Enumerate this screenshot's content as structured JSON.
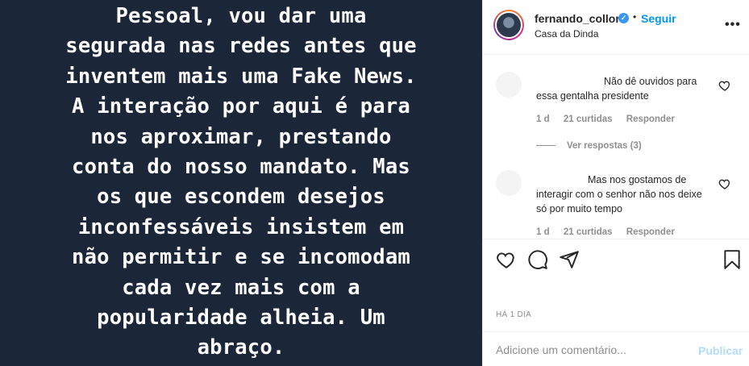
{
  "post": {
    "text_lines": [
      "Pessoal, vou dar uma",
      "segurada nas redes antes que",
      "inventem mais uma Fake News.",
      "A interação por aqui é para",
      "nos aproximar, prestando",
      "conta do nosso mandato. Mas",
      "os que escondem desejos",
      "inconfessáveis insistem em",
      "não permitir e se incomodam",
      "cada vez mais com a",
      "popularidade alheia. Um",
      "abraço."
    ],
    "background_color": "#1b2638"
  },
  "header": {
    "username": "fernando_collor",
    "verified_icon": "✓",
    "separator": "•",
    "follow_label": "Seguir",
    "location": "Casa da Dinda",
    "more_label": "•••"
  },
  "comments": [
    {
      "text": "Não dê ouvidos para essa gentalha presidente",
      "time": "1 d",
      "likes": "21 curtidas",
      "reply_label": "Responder",
      "view_replies": "Ver respostas (3)"
    },
    {
      "text": "Mas nos gostamos de interagir com o senhor não nos deixe só por muito tempo",
      "time": "1 d",
      "likes": "21 curtidas",
      "reply_label": "Responder"
    }
  ],
  "footer": {
    "time_ago": "HÁ 1 DIA",
    "comment_placeholder": "Adicione um comentário...",
    "publish_label": "Publicar"
  },
  "colors": {
    "accent": "#0095f6",
    "verified": "#3897f0",
    "muted": "#8e8e8e",
    "publish_disabled": "#b3dbff"
  }
}
